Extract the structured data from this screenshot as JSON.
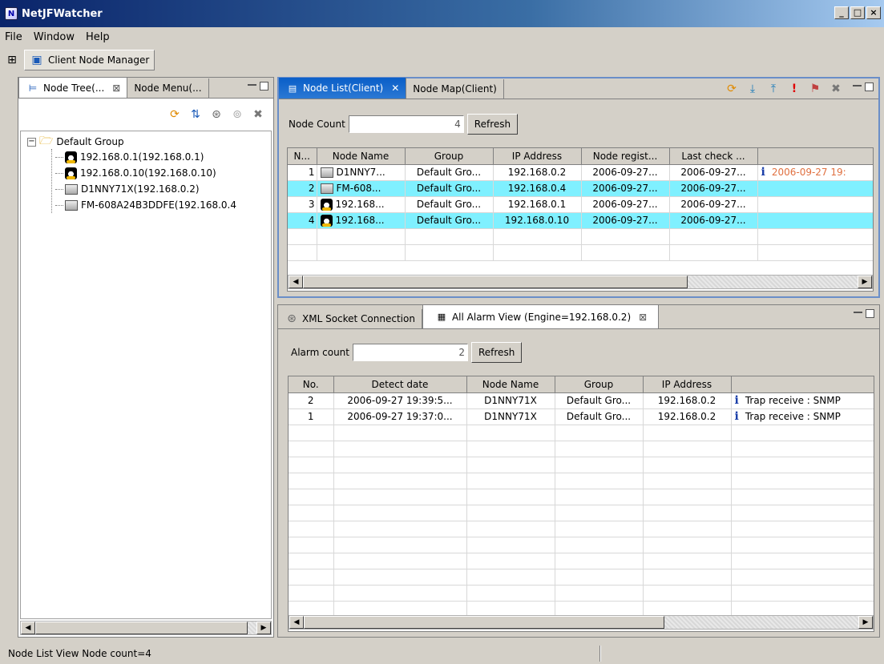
{
  "window": {
    "title": "NetJFWatcher"
  },
  "menu": [
    "File",
    "Window",
    "Help"
  ],
  "perspective": {
    "label": "Client Node Manager"
  },
  "left_panel": {
    "tabs": [
      {
        "label": "Node Tree(..."
      },
      {
        "label": "Node Menu(..."
      }
    ],
    "tree": {
      "group": "Default Group",
      "nodes": [
        {
          "label": "192.168.0.1(192.168.0.1)",
          "icon": "linux-icon"
        },
        {
          "label": "192.168.0.10(192.168.0.10)",
          "icon": "linux-icon"
        },
        {
          "label": "D1NNY71X(192.168.0.2)",
          "icon": "computer-icon"
        },
        {
          "label": "FM-608A24B3DDFE(192.168.0.4",
          "icon": "computer-icon"
        }
      ]
    }
  },
  "node_list": {
    "tabs": [
      {
        "label": "Node List(Client)"
      },
      {
        "label": "Node Map(Client)"
      }
    ],
    "count_label": "Node Count",
    "count_value": "4",
    "refresh_label": "Refresh",
    "columns": [
      "N...",
      "Node Name",
      "Group",
      "IP Address",
      "Node regist...",
      "Last check ...",
      ""
    ],
    "rows": [
      {
        "no": "1",
        "icon": "computer-icon",
        "name": "D1NNY7...",
        "group": "Default Gro...",
        "ip": "192.168.0.2",
        "reg": "2006-09-27...",
        "last": "2006-09-27...",
        "extra": "2006-09-27 19:",
        "has_info": true,
        "highlight": false
      },
      {
        "no": "2",
        "icon": "computer-icon",
        "name": "FM-608...",
        "group": "Default Gro...",
        "ip": "192.168.0.4",
        "reg": "2006-09-27...",
        "last": "2006-09-27...",
        "extra": "",
        "has_info": false,
        "highlight": true
      },
      {
        "no": "3",
        "icon": "linux-icon",
        "name": "192.168...",
        "group": "Default Gro...",
        "ip": "192.168.0.1",
        "reg": "2006-09-27...",
        "last": "2006-09-27...",
        "extra": "",
        "has_info": false,
        "highlight": false
      },
      {
        "no": "4",
        "icon": "linux-icon",
        "name": "192.168...",
        "group": "Default Gro...",
        "ip": "192.168.0.10",
        "reg": "2006-09-27...",
        "last": "2006-09-27...",
        "extra": "",
        "has_info": false,
        "highlight": true
      }
    ]
  },
  "alarm_view": {
    "tabs": [
      {
        "label": "XML Socket Connection"
      },
      {
        "label": "All Alarm View (Engine=192.168.0.2)"
      }
    ],
    "count_label": "Alarm count",
    "count_value": "2",
    "refresh_label": "Refresh",
    "columns": [
      "No.",
      "Detect date",
      "Node Name",
      "Group",
      "IP Address",
      ""
    ],
    "rows": [
      {
        "no": "2",
        "date": "2006-09-27 19:39:5...",
        "name": "D1NNY71X",
        "group": "Default Gro...",
        "ip": "192.168.0.2",
        "msg": "Trap receive : SNMP"
      },
      {
        "no": "1",
        "date": "2006-09-27 19:37:0...",
        "name": "D1NNY71X",
        "group": "Default Gro...",
        "ip": "192.168.0.2",
        "msg": "Trap receive : SNMP"
      }
    ]
  },
  "status": {
    "text": "Node List View Node count=4"
  },
  "colors": {
    "title_bar": "#0a246a",
    "active_tab": "#0a5ec8",
    "row_highlight": "#7ff0ff",
    "date_accent": "#e07040"
  }
}
